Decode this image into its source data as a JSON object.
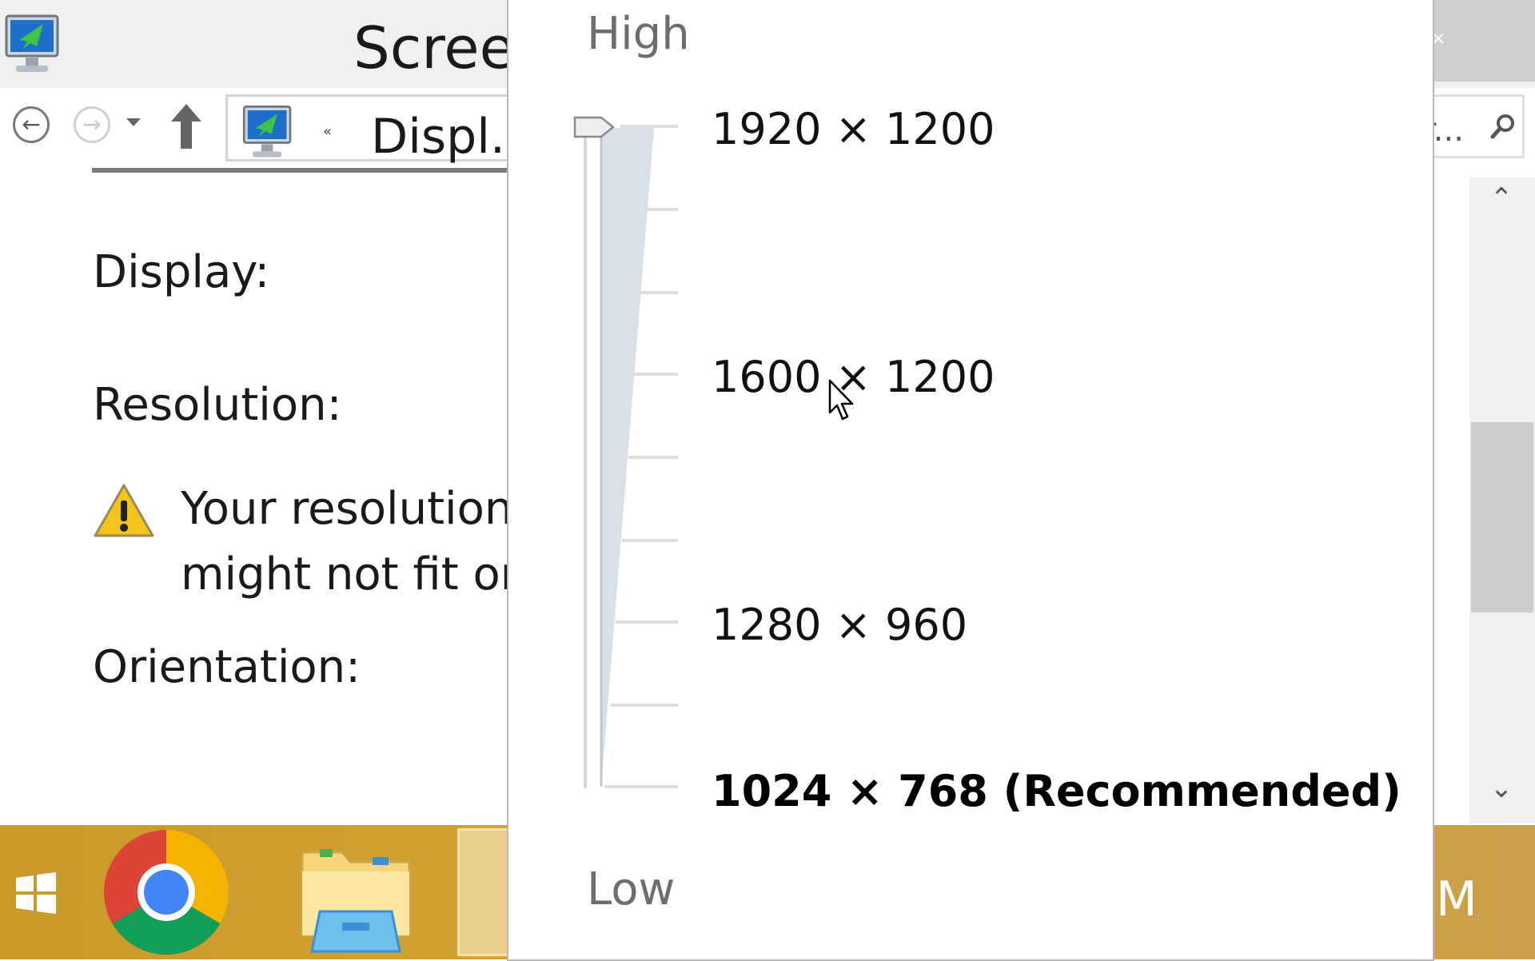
{
  "window": {
    "title": "Screen",
    "close_glyph": "×"
  },
  "navigation": {
    "back_glyph": "←",
    "forward_glyph": "→",
    "breadcrumb_separator": "«",
    "breadcrumb": "Displ...",
    "search_placeholder": "r..."
  },
  "settings": {
    "display_label": "Display:",
    "resolution_label": "Resolution:",
    "warning_line1": "Your resolution",
    "warning_line2": "might not fit on",
    "orientation_label": "Orientation:"
  },
  "resolution_popup": {
    "high_label": "High",
    "low_label": "Low",
    "options": [
      "1920 × 1200",
      "1600 × 1200",
      "1280 × 960",
      "1024 × 768 (Recommended)"
    ],
    "selected_value": "1920 × 1200",
    "slider_level": 1.0
  },
  "scrollbar": {
    "up_glyph": "⌃",
    "down_glyph": "⌄"
  },
  "taskbar": {
    "items": [
      "start-icon",
      "chrome-icon",
      "file-explorer-icon",
      "screen-resolution-icon"
    ],
    "clock_fragment": "M"
  },
  "colors": {
    "taskbar": "#d6a636",
    "slider_fill": "#d9e1e8",
    "popup_label": "#6d6d6d"
  }
}
